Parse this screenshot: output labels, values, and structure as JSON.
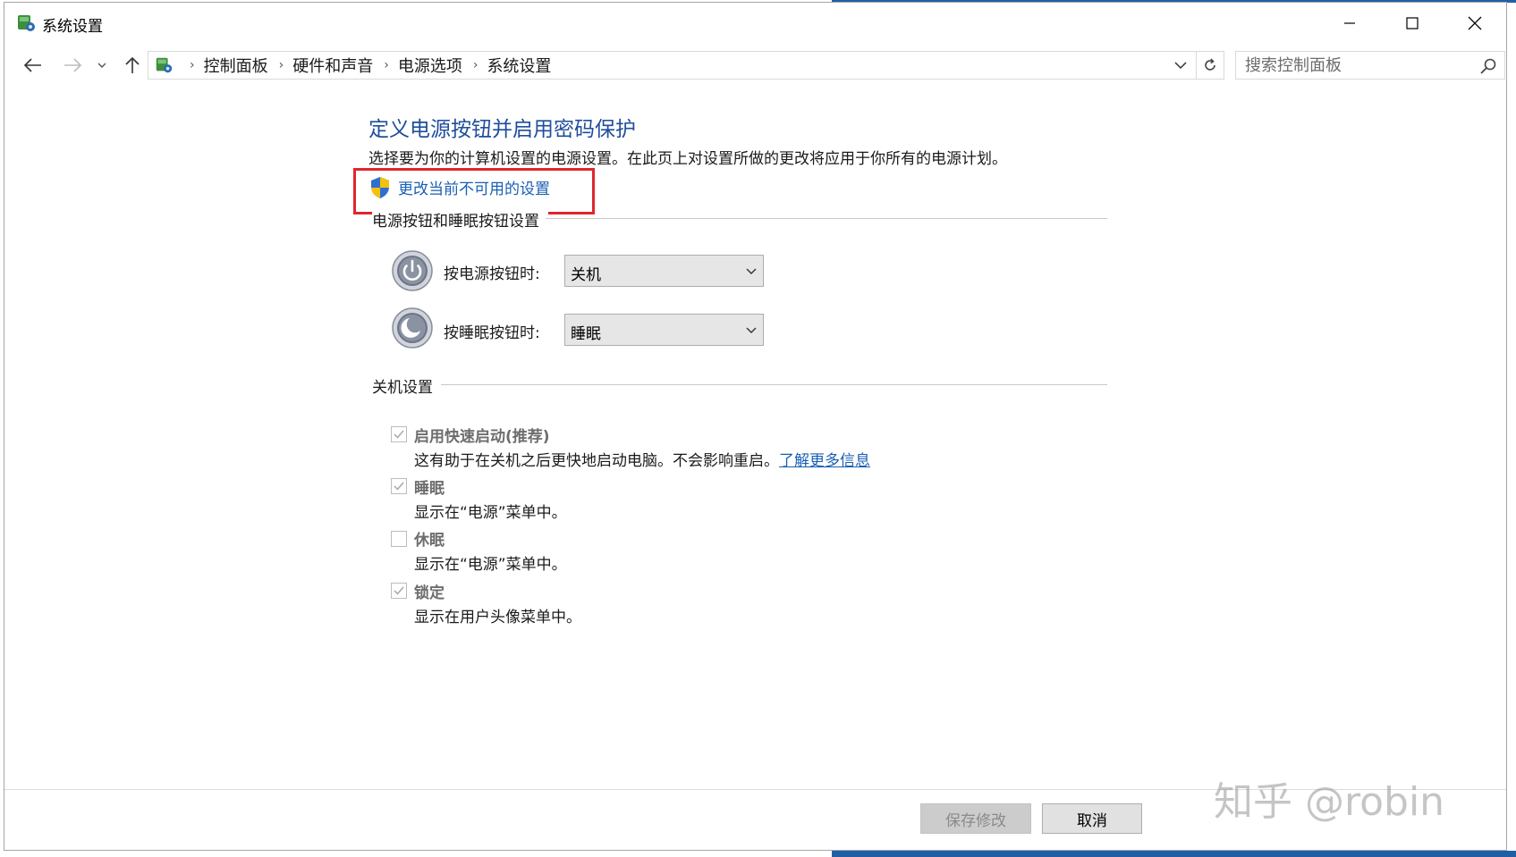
{
  "window": {
    "title": "系统设置"
  },
  "nav": {
    "breadcrumbs": [
      "控制面板",
      "硬件和声音",
      "电源选项",
      "系统设置"
    ],
    "search_placeholder": "搜索控制面板"
  },
  "main": {
    "title": "定义电源按钮并启用密码保护",
    "description": "选择要为你的计算机设置的电源设置。在此页上对设置所做的更改将应用于你所有的电源计划。",
    "change_link": "更改当前不可用的设置",
    "power_section": {
      "heading": "电源按钮和睡眠按钮设置",
      "rows": [
        {
          "label": "按电源按钮时:",
          "value": "关机",
          "icon": "power-button-icon"
        },
        {
          "label": "按睡眠按钮时:",
          "value": "睡眠",
          "icon": "sleep-button-icon"
        }
      ]
    },
    "shutdown_section": {
      "heading": "关机设置",
      "options": [
        {
          "label": "启用快速启动(推荐)",
          "desc": "这有助于在关机之后更快地启动电脑。不会影响重启。",
          "link": "了解更多信息",
          "checked": true
        },
        {
          "label": "睡眠",
          "desc": "显示在“电源”菜单中。",
          "checked": true
        },
        {
          "label": "休眠",
          "desc": "显示在“电源”菜单中。",
          "checked": false
        },
        {
          "label": "锁定",
          "desc": "显示在用户头像菜单中。",
          "checked": true
        }
      ]
    }
  },
  "footer": {
    "save_label": "保存修改",
    "cancel_label": "取消"
  },
  "watermark": "知乎 @robin",
  "colors": {
    "title_blue": "#1f4e9b",
    "link_blue": "#1a5fb4",
    "highlight_red": "#e0262e",
    "desktop_blue": "#1f5fa8"
  }
}
